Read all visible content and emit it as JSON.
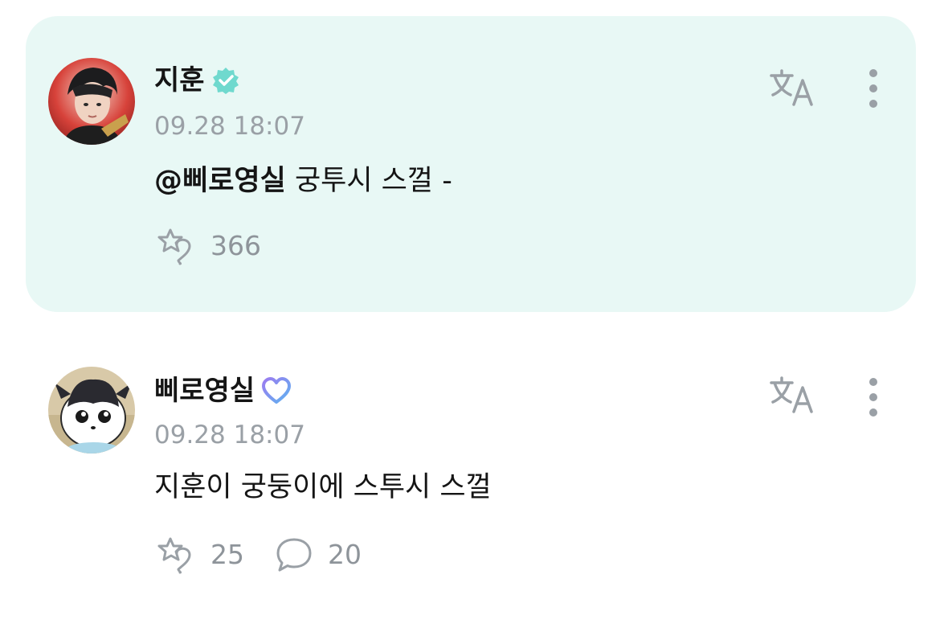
{
  "posts": [
    {
      "author": "지훈",
      "badge": "verified-check-badge",
      "timestamp": "09.28 18:07",
      "mention": "@삐로영실",
      "text": " 궁투시 스껄 -",
      "like_count": "366",
      "highlighted": true,
      "bg_color": "#e8f8f5",
      "badge_color": "#6fd9ce"
    },
    {
      "author": "삐로영실",
      "badge": "heart-outline-badge",
      "timestamp": "09.28 18:07",
      "text": "지훈이 궁둥이에 스투시 스껄",
      "like_count": "25",
      "comment_count": "20",
      "highlighted": false,
      "badge_color": "#7b8ff0"
    }
  ],
  "icons": {
    "translate": "translate-icon",
    "more": "more-vertical-icon",
    "like": "star-heart-icon",
    "comment": "speech-bubble-icon"
  }
}
